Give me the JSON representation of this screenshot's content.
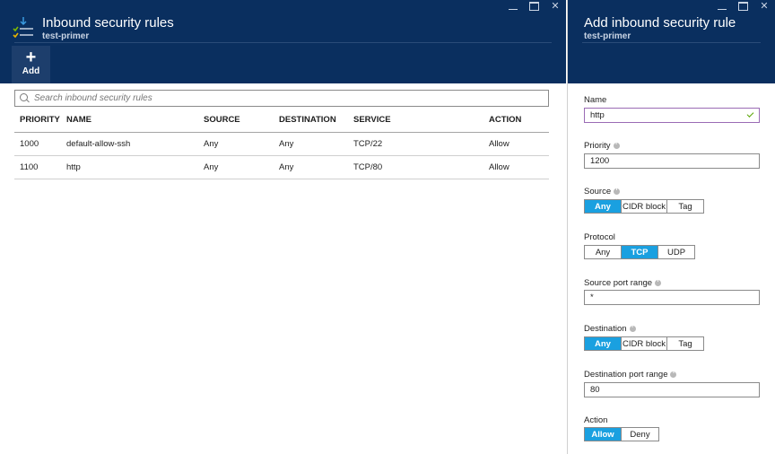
{
  "left_blade": {
    "title": "Inbound security rules",
    "subtitle": "test-primer",
    "add_label": "Add",
    "search_placeholder": "Search inbound security rules",
    "columns": [
      "PRIORITY",
      "NAME",
      "SOURCE",
      "DESTINATION",
      "SERVICE",
      "ACTION"
    ],
    "rows": [
      [
        "1000",
        "default-allow-ssh",
        "Any",
        "Any",
        "TCP/22",
        "Allow"
      ],
      [
        "1100",
        "http",
        "Any",
        "Any",
        "TCP/80",
        "Allow"
      ]
    ]
  },
  "right_blade": {
    "title": "Add inbound security rule",
    "subtitle": "test-primer",
    "name_label": "Name",
    "name_value": "http",
    "priority_label": "Priority",
    "priority_value": "1200",
    "source_label": "Source",
    "source_options": [
      "Any",
      "CIDR block",
      "Tag"
    ],
    "source_selected": "Any",
    "protocol_label": "Protocol",
    "protocol_options": [
      "Any",
      "TCP",
      "UDP"
    ],
    "protocol_selected": "TCP",
    "source_port_label": "Source port range",
    "source_port_value": "*",
    "destination_label": "Destination",
    "destination_options": [
      "Any",
      "CIDR block",
      "Tag"
    ],
    "destination_selected": "Any",
    "dest_port_label": "Destination port range",
    "dest_port_value": "80",
    "action_label": "Action",
    "action_options": [
      "Allow",
      "Deny"
    ],
    "action_selected": "Allow"
  },
  "colors": {
    "header_bg": "#0a2f5f",
    "selected": "#1aa0e0",
    "valid_check": "#57a300"
  },
  "icons": [
    "security-rules-icon",
    "add-plus-icon",
    "search-icon",
    "minimize-icon",
    "maximize-icon",
    "close-icon",
    "info-icon",
    "check-icon"
  ]
}
